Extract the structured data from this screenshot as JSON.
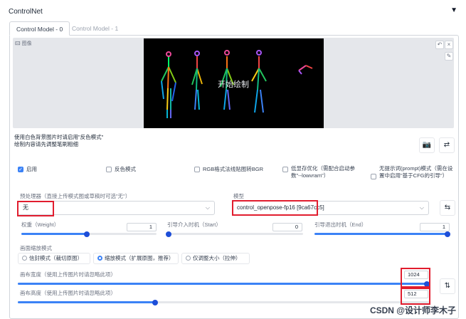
{
  "header": {
    "title": "ControlNet",
    "collapse_icon": "triangle-down-icon"
  },
  "tabs": [
    {
      "label": "Control Model - 0",
      "active": true
    },
    {
      "label": "Control Model - 1",
      "active": false
    }
  ],
  "image_panel": {
    "label": "图像",
    "overlay_text": "开始绘制",
    "tools": {
      "undo": "undo-icon",
      "clear": "close-icon",
      "draw": "pen-icon"
    }
  },
  "hints": {
    "line1": "使用白色背景图片时请启用\"反色模式\"",
    "line2": "绘制内容请先调整笔刷粗细"
  },
  "checkboxes": {
    "enable": {
      "label": "启用",
      "checked": true
    },
    "invert": {
      "label": "反色模式",
      "checked": false
    },
    "rgb_bgr": {
      "label": "RGB格式法线贴图转BGR",
      "checked": false
    },
    "lowvram": {
      "label": "低显存优化（需配合启动参数\"--lowvram\"）",
      "checked": false
    },
    "guess_mode": {
      "label": "无提示词(prompt)模式（需在设置中启用\"基于CFG的引导\"）",
      "checked": false
    }
  },
  "preprocessor": {
    "label": "预处理器（直接上传模式图或草稿时可选\"无\"）",
    "value": "无"
  },
  "model": {
    "label": "模型",
    "value": "control_openpose-fp16 [9ca67cc5]"
  },
  "sliders": {
    "weight": {
      "label": "权重（Weight）",
      "value": "1",
      "fraction": 0.5
    },
    "start": {
      "label": "引导介入时机（Start）",
      "value": "0",
      "fraction": 0.0
    },
    "end": {
      "label": "引导退出时机（End）",
      "value": "1",
      "fraction": 1.0
    }
  },
  "resize_mode": {
    "label": "画面缩放模式",
    "options": [
      {
        "label": "信封模式（裁切原图）",
        "selected": false
      },
      {
        "label": "缩放模式（扩展原图，推荐）",
        "selected": true
      },
      {
        "label": "仅调整大小（拉伸）",
        "selected": false
      }
    ]
  },
  "canvas_width": {
    "label": "画布宽度（使用上传图片时请忽略此项）",
    "value": "1024",
    "fraction": 1.0
  },
  "canvas_height": {
    "label": "画布高度（使用上传图片时请忽略此项）",
    "value": "512",
    "fraction": 0.33
  },
  "watermark": "CSDN @设计师李木子"
}
